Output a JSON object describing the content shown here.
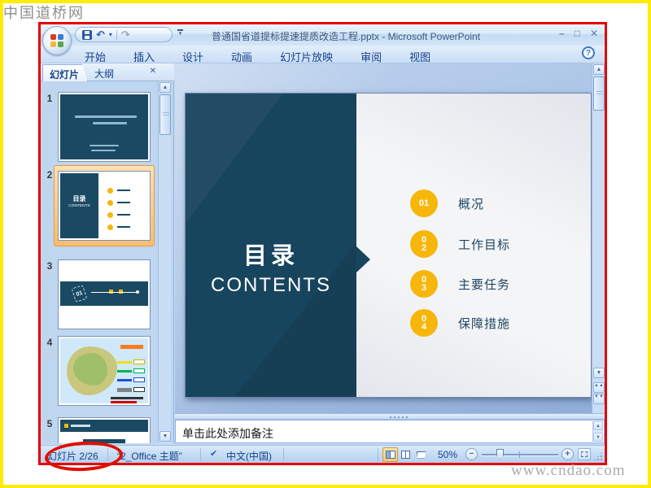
{
  "watermarks": {
    "top_left": "中国道桥网",
    "bottom_right": "www.cndao.com"
  },
  "icons": {
    "minimize": "–",
    "maximize": "□",
    "close": "✕",
    "undo": "↶",
    "redo": "↷",
    "dropdown": "▾",
    "pane_close": "✕",
    "help": "?",
    "up_arrow": "▲",
    "down_arrow": "▼",
    "double_up": "▲▲",
    "double_down": "▼▼",
    "star": "☆",
    "check": "✔",
    "minus": "−",
    "plus": "+"
  },
  "title_bar": {
    "title": "普通国省道提标提速提质改造工程.pptx - Microsoft PowerPoint"
  },
  "ribbon": {
    "tabs": [
      "开始",
      "插入",
      "设计",
      "动画",
      "幻灯片放映",
      "审阅",
      "视图"
    ]
  },
  "sidebar": {
    "tab_slides": "幻灯片",
    "tab_outline": "大纲",
    "slides": [
      {
        "number": "1"
      },
      {
        "number": "2"
      },
      {
        "number": "3",
        "tag": "01"
      },
      {
        "number": "4"
      },
      {
        "number": "5"
      }
    ]
  },
  "slide": {
    "title_cn": "目录",
    "title_en": "CONTENTS",
    "items": [
      {
        "num": "01",
        "label": "概况"
      },
      {
        "num": "02",
        "label": "工作目标"
      },
      {
        "num": "03",
        "label": "主要任务"
      },
      {
        "num": "04",
        "label": "保障措施"
      }
    ]
  },
  "notes": {
    "placeholder": "单击此处添加备注"
  },
  "status_bar": {
    "slide_indicator": "幻灯片 2/26",
    "theme": "“2_Office 主题”",
    "language": "中文(中国)",
    "zoom": "50%"
  },
  "colors": {
    "navy": "#18455E",
    "accent_yellow": "#F7B60B",
    "selection_orange": "#F0A43C",
    "annotation_red": "#E01000"
  }
}
